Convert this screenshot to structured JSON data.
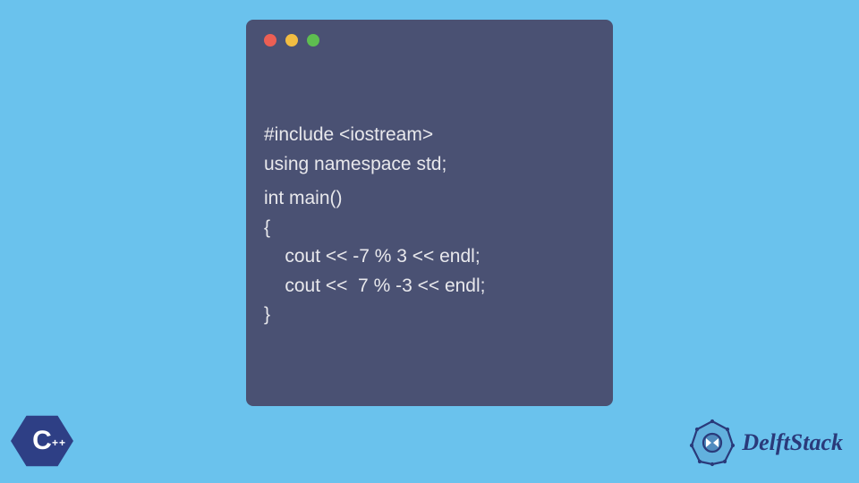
{
  "code": {
    "line1": "#include <iostream>",
    "line2": "using namespace std;",
    "line3": "int main()",
    "line4": "{",
    "line5": "    cout << -7 % 3 << endl;",
    "line6": "    cout <<  7 % -3 << endl;",
    "line7": "}"
  },
  "window": {
    "dot_red": "#ec5f54",
    "dot_yellow": "#f2bd42",
    "dot_green": "#5ebe50",
    "background": "#4a5173"
  },
  "cpp_badge": {
    "letter": "C",
    "plus": "++"
  },
  "brand": {
    "name": "DelftStack"
  },
  "colors": {
    "page_bg": "#6ac2ed",
    "code_text": "#e8e8ec",
    "brand_blue": "#2a3a7a"
  }
}
